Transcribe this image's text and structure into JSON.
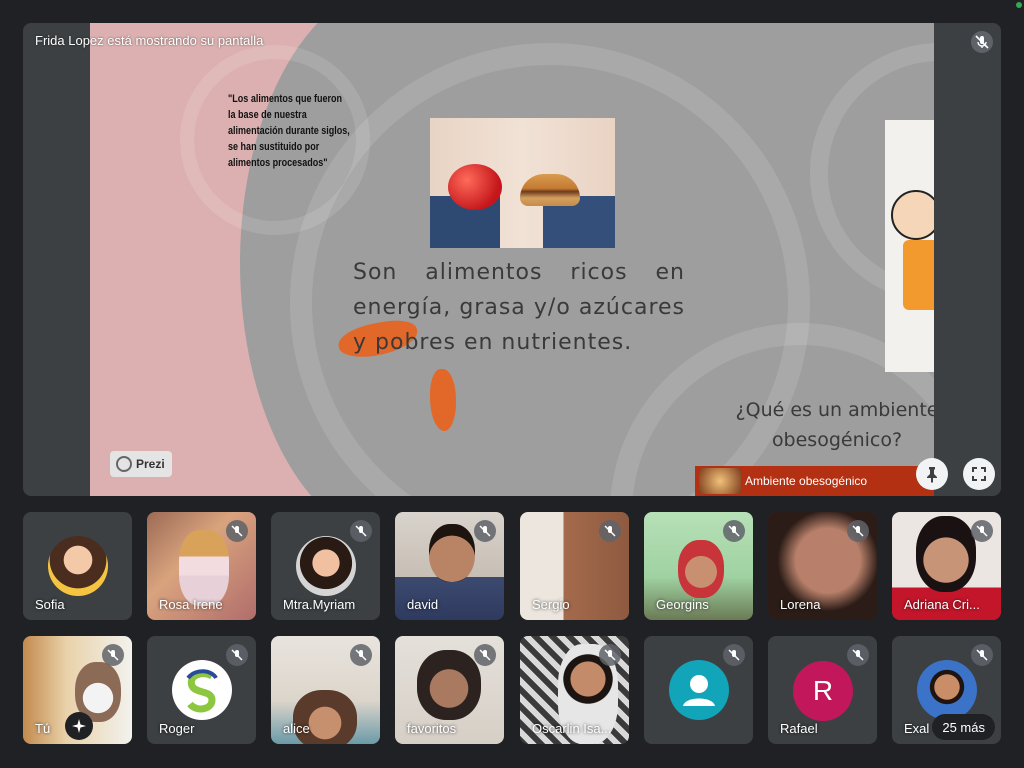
{
  "stage": {
    "presenter_label": "Frida Lopez está mostrando su pantalla",
    "slide": {
      "quote": "\"Los alimentos que fueron la base de nuestra alimentación durante siglos, se han sustituido por alimentos procesados\"",
      "body": "Son alimentos ricos en energía, grasa y/o azúcares y pobres en nutrientes.",
      "question": "¿Qué es un ambiente obesogénico?",
      "video_caption": "Ambiente obesogénico",
      "prezi_label": "Prezi"
    },
    "pin_icon": "pin-icon",
    "fullscreen_icon": "fullscreen-icon"
  },
  "participants": [
    {
      "name": "Sofia",
      "muted": false
    },
    {
      "name": "Rosa Irene",
      "muted": true
    },
    {
      "name": "Mtra.Myriam",
      "muted": true
    },
    {
      "name": "david",
      "muted": true
    },
    {
      "name": "Sergio",
      "muted": true
    },
    {
      "name": "Georgins",
      "muted": true
    },
    {
      "name": "Lorena",
      "muted": true
    },
    {
      "name": "Adriana Cri...",
      "muted": true
    },
    {
      "name": "Tú",
      "muted": true
    },
    {
      "name": "Roger",
      "muted": true
    },
    {
      "name": "alice",
      "muted": true
    },
    {
      "name": "favoritos",
      "muted": true
    },
    {
      "name": "Oscarlin Isa...",
      "muted": true
    },
    {
      "name": "",
      "muted": true
    },
    {
      "name": "Rafael",
      "muted": true,
      "initial": "R"
    },
    {
      "name": "Exal",
      "muted": true
    }
  ],
  "more_count_label": "25 más",
  "colors": {
    "background": "#202124",
    "tile": "#3c4043",
    "rafael_avatar": "#c2185b",
    "default_avatar": "#12a4b8"
  }
}
